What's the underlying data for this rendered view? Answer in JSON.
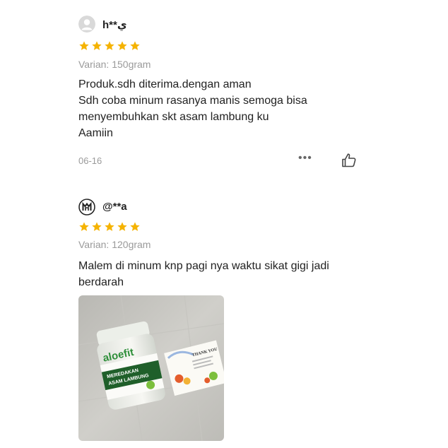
{
  "reviews": [
    {
      "username": "h**ي",
      "avatar_icon": "default-user-avatar",
      "rating": 5,
      "variant": "Varian: 150gram",
      "comment_lines": [
        "Produk.sdh diterima.dengan aman",
        "Sdh coba minum rasanya manis semoga bisa",
        "menyembuhkan skt asam lambung ku",
        "Aamiin"
      ],
      "date": "06-16",
      "more_icon": "more-dots-icon",
      "like_icon": "thumbs-up-icon"
    },
    {
      "username": "@**a",
      "avatar_icon": "logo-avatar",
      "rating": 5,
      "variant": "Varian: 120gram",
      "comment_lines": [
        "Malem di minum knp pagi nya waktu sikat gigi jadi",
        "berdarah"
      ],
      "photo": {
        "jar_brand": "aloefit",
        "jar_label_line1": "MEREDAKAN",
        "jar_label_line2": "ASAM LAMBUNG",
        "card_text": "THANK YOU"
      }
    }
  ],
  "colors": {
    "star": "#F5B301",
    "muted_text": "#9a9a9a",
    "text": "#222222"
  }
}
